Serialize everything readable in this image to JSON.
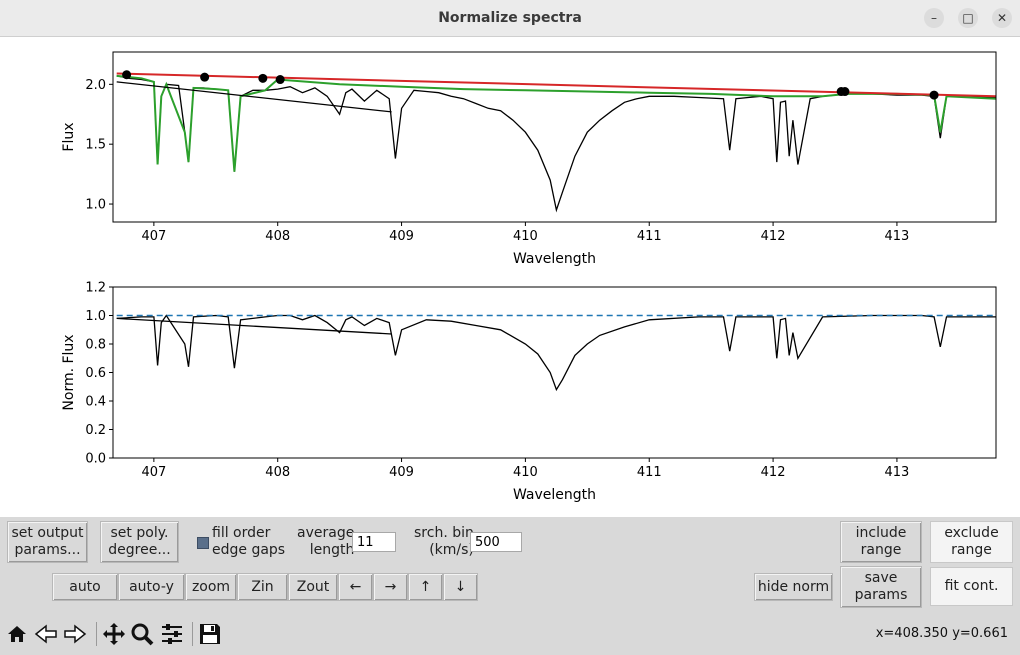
{
  "window": {
    "title": "Normalize spectra",
    "buttons": [
      "minimize-icon",
      "maximize-icon",
      "close-icon"
    ]
  },
  "chart_data": [
    {
      "type": "line",
      "xlabel": "Wavelength",
      "ylabel": "Flux",
      "xlim": [
        406.67,
        413.8
      ],
      "ylim": [
        0.85,
        2.27
      ],
      "xticks": [
        "407",
        "408",
        "409",
        "410",
        "411",
        "412",
        "413"
      ],
      "yticks": [
        "1.0",
        "1.5",
        "2.0"
      ],
      "grid": false,
      "series": [
        {
          "color": "#000000",
          "x": [
            406.7,
            406.8,
            406.9,
            407.0,
            407.03,
            407.06,
            407.1,
            407.2,
            407.25,
            407.28,
            407.32,
            407.4,
            407.5,
            407.6,
            407.65,
            407.7,
            407.8,
            407.9,
            408.0,
            408.1,
            408.2,
            408.3,
            408.4,
            408.5,
            408.55,
            408.6,
            408.7,
            408.8,
            408.9,
            408.95,
            409.0,
            409.1,
            409.2,
            409.3,
            409.4,
            409.5,
            409.6,
            409.7,
            409.8,
            409.9,
            410.0,
            410.1,
            410.2,
            410.25,
            410.3,
            410.4,
            410.5,
            410.6,
            410.7,
            410.8,
            410.9,
            411.0,
            411.2,
            411.4,
            411.6,
            411.65,
            411.7,
            411.8,
            411.9,
            412.0,
            412.03,
            412.06,
            412.1,
            412.13,
            412.16,
            412.2,
            412.3,
            412.4,
            412.6,
            412.8,
            413.0,
            413.2,
            413.3,
            413.35,
            413.4,
            413.6,
            413.8
          ],
          "y": [
            2.07,
            2.05,
            2.04,
            2.02,
            1.33,
            1.9,
            2.0,
            1.99,
            1.6,
            1.35,
            1.97,
            1.97,
            1.96,
            1.95,
            1.27,
            1.9,
            1.95,
            1.95,
            1.96,
            1.98,
            1.93,
            1.97,
            1.9,
            1.75,
            1.93,
            1.96,
            1.86,
            1.95,
            1.88,
            1.38,
            1.8,
            1.95,
            1.94,
            1.93,
            1.9,
            1.88,
            1.84,
            1.8,
            1.78,
            1.7,
            1.6,
            1.45,
            1.2,
            0.95,
            1.1,
            1.4,
            1.6,
            1.7,
            1.78,
            1.85,
            1.88,
            1.9,
            1.9,
            1.89,
            1.88,
            1.45,
            1.88,
            1.89,
            1.9,
            1.88,
            1.35,
            1.85,
            1.86,
            1.4,
            1.7,
            1.33,
            1.88,
            1.9,
            1.92,
            1.92,
            1.91,
            1.91,
            1.9,
            1.55,
            1.9,
            1.9,
            1.89
          ]
        },
        {
          "color": "#2ca02c",
          "x": [
            406.7,
            406.9,
            407.0,
            407.03,
            407.06,
            407.1,
            407.25,
            407.28,
            407.32,
            407.5,
            407.6,
            407.65,
            407.7,
            407.9,
            408.0,
            408.5,
            409.0,
            409.5,
            410.0,
            410.5,
            411.0,
            411.5,
            412.0,
            412.4,
            412.6,
            413.0,
            413.3,
            413.35,
            413.4,
            413.8
          ],
          "y": [
            2.07,
            2.05,
            2.02,
            1.33,
            1.9,
            2.0,
            1.6,
            1.35,
            1.97,
            1.96,
            1.95,
            1.27,
            1.9,
            1.95,
            2.04,
            2.0,
            1.98,
            1.96,
            1.95,
            1.94,
            1.93,
            1.92,
            1.9,
            1.9,
            1.92,
            1.92,
            1.91,
            1.6,
            1.9,
            1.88
          ]
        },
        {
          "color": "#d62728",
          "x": [
            406.7,
            413.8
          ],
          "y": [
            2.09,
            1.9
          ]
        },
        {
          "color": "#000000",
          "x": [
            406.7,
            408.92
          ],
          "y": [
            2.02,
            1.77
          ]
        }
      ],
      "points": {
        "color": "#000000",
        "x": [
          406.78,
          407.41,
          407.88,
          408.02,
          412.55,
          412.58,
          413.3
        ],
        "y": [
          2.08,
          2.06,
          2.05,
          2.04,
          1.94,
          1.94,
          1.91
        ]
      }
    },
    {
      "type": "line",
      "xlabel": "Wavelength",
      "ylabel": "Norm. Flux",
      "xlim": [
        406.67,
        413.8
      ],
      "ylim": [
        0.0,
        1.2
      ],
      "xticks": [
        "407",
        "408",
        "409",
        "410",
        "411",
        "412",
        "413"
      ],
      "yticks": [
        "0.0",
        "0.2",
        "0.4",
        "0.6",
        "0.8",
        "1.0",
        "1.2"
      ],
      "grid": false,
      "series": [
        {
          "color": "#000000",
          "x": [
            406.7,
            406.9,
            407.0,
            407.03,
            407.06,
            407.1,
            407.25,
            407.28,
            407.32,
            407.5,
            407.6,
            407.65,
            407.7,
            407.9,
            408.0,
            408.1,
            408.2,
            408.3,
            408.4,
            408.5,
            408.55,
            408.6,
            408.7,
            408.8,
            408.9,
            408.95,
            409.0,
            409.2,
            409.4,
            409.6,
            409.8,
            410.0,
            410.1,
            410.2,
            410.25,
            410.3,
            410.4,
            410.5,
            410.6,
            410.8,
            411.0,
            411.4,
            411.6,
            411.65,
            411.7,
            411.9,
            412.0,
            412.03,
            412.06,
            412.1,
            412.13,
            412.16,
            412.2,
            412.4,
            412.8,
            413.2,
            413.3,
            413.35,
            413.4,
            413.8
          ],
          "y": [
            0.98,
            0.99,
            0.99,
            0.65,
            0.95,
            1.0,
            0.8,
            0.64,
            0.99,
            1.0,
            0.99,
            0.63,
            0.97,
            0.99,
            1.0,
            1.0,
            0.97,
            1.0,
            0.95,
            0.88,
            0.97,
            0.99,
            0.93,
            0.98,
            0.95,
            0.72,
            0.9,
            0.97,
            0.96,
            0.93,
            0.9,
            0.8,
            0.73,
            0.6,
            0.48,
            0.55,
            0.72,
            0.8,
            0.86,
            0.92,
            0.97,
            0.99,
            0.99,
            0.75,
            0.99,
            0.99,
            0.99,
            0.7,
            0.97,
            0.98,
            0.72,
            0.88,
            0.7,
            0.99,
            1.0,
            1.0,
            0.99,
            0.78,
            0.99,
            0.99
          ]
        },
        {
          "color": "#000000",
          "x": [
            406.7,
            408.92
          ],
          "y": [
            0.98,
            0.87
          ]
        },
        {
          "color": "#1f77b4",
          "dashed": true,
          "x": [
            406.7,
            413.8
          ],
          "y": [
            1.0,
            1.0
          ]
        }
      ]
    }
  ],
  "controls": {
    "set_output": "set output\nparams...",
    "set_poly": "set poly.\ndegree...",
    "fill_order": "fill order\nedge gaps",
    "average_length_label": "average\nlength",
    "average_length_value": "11",
    "srch_bin_label": "srch. bin\n(km/s)",
    "srch_bin_value": "500",
    "include_range": "include\nrange",
    "exclude_range": "exclude\nrange",
    "auto": "auto",
    "auto_y": "auto-y",
    "zoom": "zoom",
    "zin": "Zin",
    "zout": "Zout",
    "left": "←",
    "right": "→",
    "up": "↑",
    "down": "↓",
    "hide_norm": "hide norm",
    "save_params": "save\nparams",
    "fit_cont": "fit cont."
  },
  "toolbar": {
    "icons": [
      "home-icon",
      "back-icon",
      "forward-icon",
      "pan-icon",
      "zoom-icon",
      "configure-icon",
      "save-icon"
    ],
    "coords": "x=408.350 y=0.661"
  }
}
